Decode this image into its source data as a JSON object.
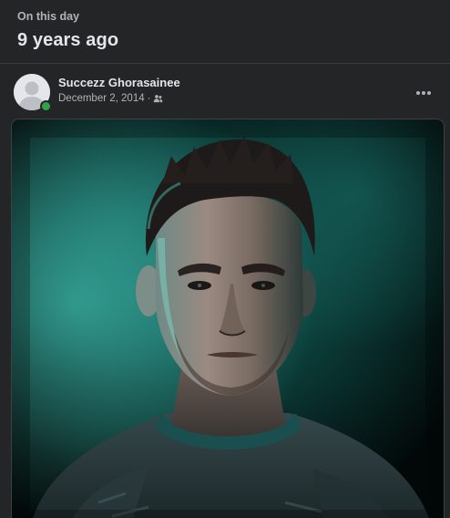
{
  "memory": {
    "kicker": "On this day",
    "title": "9 years ago"
  },
  "post": {
    "author_name": "Succezz Ghorasainee",
    "date": "December 2, 2014",
    "separator": "·",
    "audience_icon": "friends-icon",
    "online_status_color": "#31a24c",
    "more_icon": "more-horizontal-icon"
  },
  "photo": {
    "subject": "portrait-photo",
    "background_tint": "#0f5a54"
  },
  "colors": {
    "background": "#242526",
    "primary_text": "#e4e6eb",
    "secondary_text": "#b0b3b8",
    "divider": "#3a3b3c"
  }
}
